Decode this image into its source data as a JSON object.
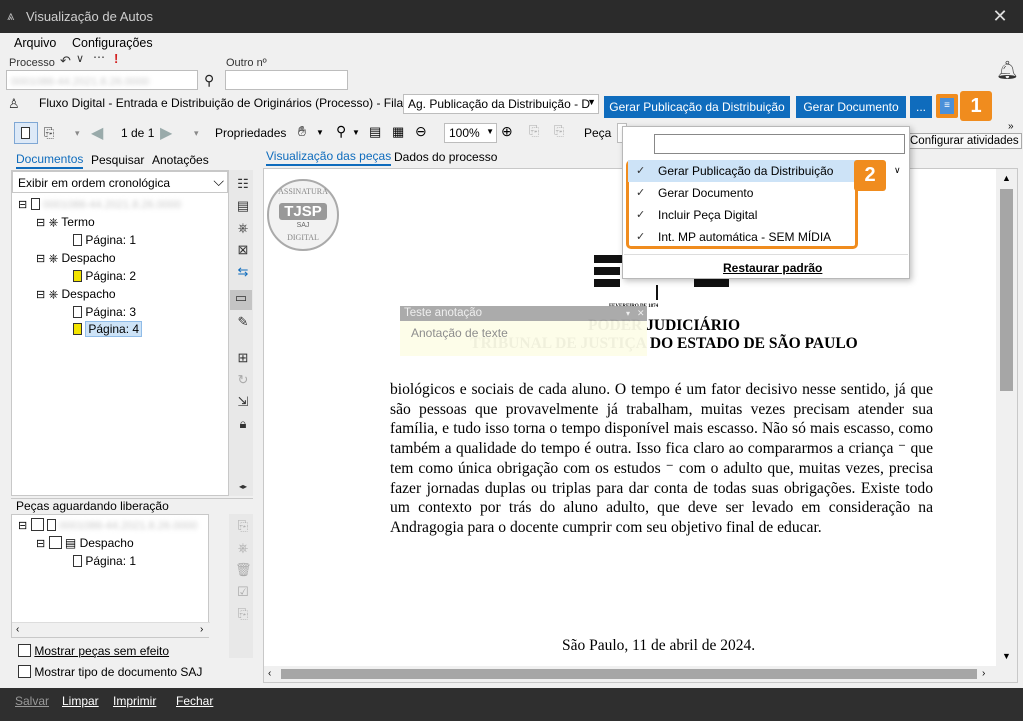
{
  "window": {
    "title": "Visualização de Autos",
    "close_glyph": "✕"
  },
  "menu": {
    "arquivo": "Arquivo",
    "configuracoes": "Configurações"
  },
  "processo": {
    "label": "Processo",
    "value": "0001086-44.2021.8.26.0000",
    "outro_label": "Outro nº",
    "outro_value": ""
  },
  "flow": {
    "text": "Fluxo Digital - Entrada e Distribuição de Originários (Processo) - Fila:",
    "fila_value": "Ag. Publicação da Distribuição - D"
  },
  "buttons": {
    "gerar_publicacao": "Gerar Publicação da Distribuição",
    "gerar_documento": "Gerar Documento",
    "more": "..."
  },
  "toolbar": {
    "page_indicator": "1 de 1",
    "propriedades": "Propriedades",
    "zoom": "100%",
    "peca_label": "Peça",
    "tooltip": "Configurar atividades"
  },
  "left_tabs": {
    "documentos": "Documentos",
    "pesquisar": "Pesquisar",
    "anotacoes": "Anotações"
  },
  "order_select": "Exibir em ordem cronológica",
  "tree": {
    "root": "0001086-44.2021.8.26.0000",
    "items": [
      {
        "label": "Termo",
        "page": "Página: 1"
      },
      {
        "label": "Despacho",
        "page": "Página: 2"
      },
      {
        "label": "Despacho",
        "page": "Página: 3",
        "page2": "Página: 4"
      }
    ]
  },
  "waiting": {
    "title": "Peças aguardando liberação",
    "root": "0001086-44.2021.8.26.0000",
    "item": "Despacho",
    "page": "Página: 1"
  },
  "checkboxes": {
    "sem_efeito": "Mostrar peças sem efeito",
    "tipo_saj": "Mostrar tipo de documento SAJ"
  },
  "main_tabs": {
    "visualizacao": "Visualização das peças",
    "dados": "Dados do processo"
  },
  "stamp": {
    "top": "ASSINATURA",
    "center": "TJSP",
    "sub": "SAJ",
    "bottom": "DIGITAL"
  },
  "annotation": {
    "title": "Teste anotação",
    "body": "Anotação de texte"
  },
  "document": {
    "header_year": "FEVEREIRO DE 1874",
    "header1": "PODER JUDICIÁRIO",
    "header2": "TRIBUNAL DE JUSTIÇA DO ESTADO DE SÃO PAULO",
    "paragraph": "biológicos e sociais de cada aluno. O tempo é um fator decisivo nesse sentido, já que são pessoas que provavelmente já trabalham, muitas vezes precisam atender sua família, e tudo isso torna o tempo disponível mais escasso. Não só mais escasso, como também a qualidade do tempo é outra. Isso fica claro ao compararmos a criança ⁻ que tem como única obrigação com os estudos ⁻ com o adulto que, muitas vezes, precisa fazer jornadas duplas ou triplas para dar conta de todas suas obrigações. Existe todo um contexto por trás do aluno adulto, que deve ser levado em consideração na Andragogia para o docente cumprir com seu objetivo final de educar.",
    "closing": "São Paulo, 11 de abril de 2024."
  },
  "dropdown": {
    "search_value": "",
    "items": [
      "Gerar Publicação da Distribuição",
      "Gerar Documento",
      "Incluir Peça Digital",
      "Int. MP automática - SEM MÍDIA"
    ],
    "restore": "Restaurar padrão"
  },
  "badges": {
    "one": "1",
    "two": "2"
  },
  "bottom": {
    "salvar": "Salvar",
    "limpar": "Limpar",
    "imprimir": "Imprimir",
    "fechar": "Fechar"
  },
  "colors": {
    "accent": "#0f6cbd",
    "badge": "#f08c1e",
    "titlebar": "#2b2b2b"
  }
}
